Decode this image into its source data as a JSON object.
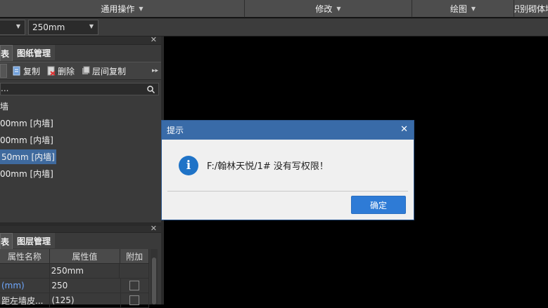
{
  "menubar": {
    "items": [
      {
        "label": "通用操作"
      },
      {
        "label": "修改"
      },
      {
        "label": "绘图"
      },
      {
        "label": "识别砌体墙"
      }
    ]
  },
  "toolbar2": {
    "combo1_value": "",
    "combo2_value": "250mm"
  },
  "component_panel": {
    "tabs": [
      {
        "label": "表"
      },
      {
        "label": "图纸管理"
      }
    ],
    "tools": {
      "copy": "复制",
      "delete": "删除",
      "floor_copy": "层间复制"
    },
    "search_text": "...",
    "tree": [
      {
        "label": "墙",
        "selected": false
      },
      {
        "label": "00mm [内墙]",
        "selected": false
      },
      {
        "label": "00mm [内墙]",
        "selected": false
      },
      {
        "label": "50mm [内墙]",
        "selected": true
      },
      {
        "label": "00mm [内墙]",
        "selected": false
      }
    ]
  },
  "property_panel": {
    "tabs": [
      {
        "label": "表"
      },
      {
        "label": "图层管理"
      }
    ],
    "headers": [
      "属性名称",
      "属性值",
      "附加"
    ],
    "rows": [
      {
        "name": "",
        "value": "250mm",
        "has_check": false
      },
      {
        "name": "(mm)",
        "value": "250",
        "has_check": true
      },
      {
        "name": "距左墙皮...",
        "value": "(125)",
        "has_check": true
      }
    ]
  },
  "dialog": {
    "title": "提示",
    "message": "F:/翰林天悦/1# 没有写权限！",
    "ok_label": "确定"
  },
  "colors": {
    "dialog_title_bg": "#396ba8",
    "ok_button_bg": "#2e7bd6",
    "selection_bg": "#3f6a9e",
    "info_icon": "#1f73c7"
  }
}
